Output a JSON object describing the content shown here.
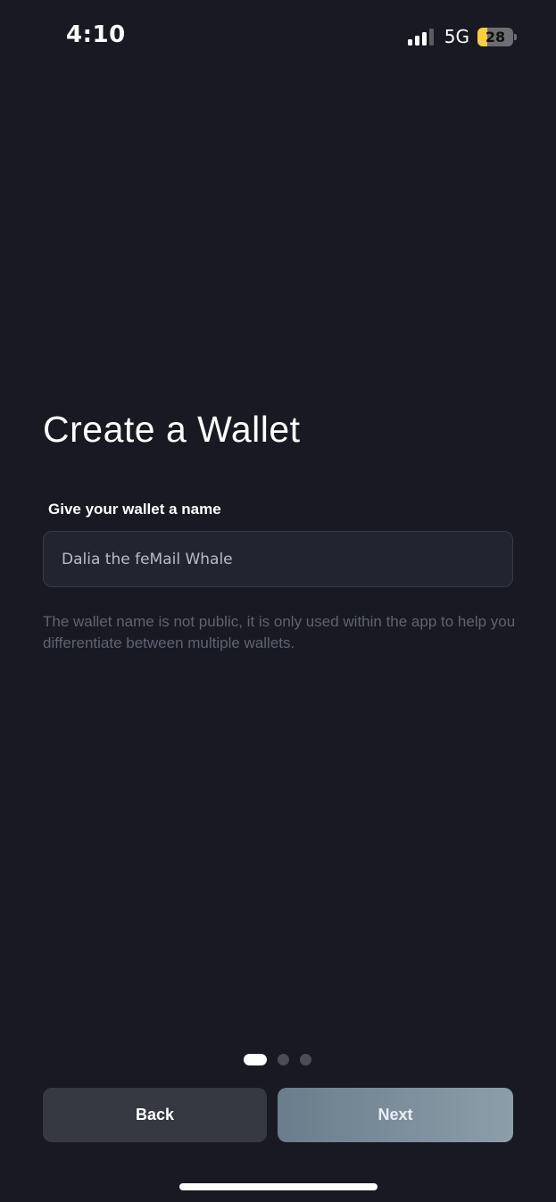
{
  "status_bar": {
    "time": "4:10",
    "network": "5G",
    "battery_level": "28",
    "battery_fill_percent": 28,
    "signal_bars_active": 3,
    "signal_bars_total": 4
  },
  "page": {
    "title": "Create a Wallet",
    "field_label": "Give your wallet a name",
    "wallet_name_value": "Dalia the feMail Whale",
    "help_text": "The wallet name is not public, it is only used within the app to help you differentiate between multiple wallets."
  },
  "pager": {
    "current_step": 1,
    "total_steps": 3
  },
  "actions": {
    "back_label": "Back",
    "next_label": "Next"
  },
  "colors": {
    "background": "#181922",
    "input_background": "#222530",
    "back_button": "#363842",
    "next_button_start": "#6a7d8c",
    "next_button_end": "#8c9ea9",
    "battery_fill": "#f5cf3c"
  }
}
